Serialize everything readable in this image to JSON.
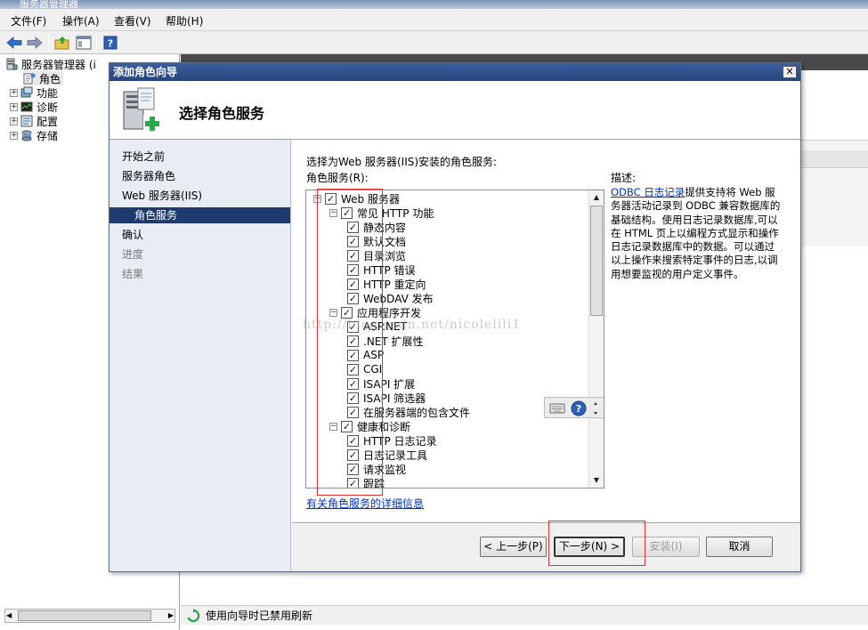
{
  "app": {
    "title": "服务器管理器",
    "menu": [
      "文件(F)",
      "操作(A)",
      "查看(V)",
      "帮助(H)"
    ],
    "tree": {
      "root": "服务器管理器 (i",
      "items": [
        "角色",
        "功能",
        "诊断",
        "配置",
        "存储"
      ]
    },
    "status_text": "使用向导时已禁用刷新"
  },
  "dialog": {
    "title": "添加角色向导",
    "close_label": "✕",
    "header_title": "选择角色服务",
    "nav": [
      "开始之前",
      "服务器角色",
      "Web 服务器(IIS)",
      "角色服务",
      "确认",
      "进度",
      "结果"
    ],
    "instruction": "选择为Web 服务器(IIS)安装的角色服务:",
    "list_label": "角色服务(R):",
    "tree": [
      {
        "label": "Web 服务器",
        "level": 0,
        "expander": "⊟",
        "checked": true
      },
      {
        "label": "常见 HTTP 功能",
        "level": 1,
        "expander": "⊟",
        "checked": true
      },
      {
        "label": "静态内容",
        "level": 2,
        "checked": true
      },
      {
        "label": "默认文档",
        "level": 2,
        "checked": true
      },
      {
        "label": "目录浏览",
        "level": 2,
        "checked": true
      },
      {
        "label": "HTTP 错误",
        "level": 2,
        "checked": true
      },
      {
        "label": "HTTP 重定向",
        "level": 2,
        "checked": true
      },
      {
        "label": "WebDAV 发布",
        "level": 2,
        "checked": true
      },
      {
        "label": "应用程序开发",
        "level": 1,
        "expander": "⊟",
        "checked": true
      },
      {
        "label": "ASP.NET",
        "level": 2,
        "checked": true
      },
      {
        "label": ".NET 扩展性",
        "level": 2,
        "checked": true
      },
      {
        "label": "ASP",
        "level": 2,
        "checked": true
      },
      {
        "label": "CGI",
        "level": 2,
        "checked": true
      },
      {
        "label": "ISAPI 扩展",
        "level": 2,
        "checked": true
      },
      {
        "label": "ISAPI 筛选器",
        "level": 2,
        "checked": true
      },
      {
        "label": "在服务器端的包含文件",
        "level": 2,
        "checked": true
      },
      {
        "label": "健康和诊断",
        "level": 1,
        "expander": "⊟",
        "checked": true
      },
      {
        "label": "HTTP 日志记录",
        "level": 2,
        "checked": true
      },
      {
        "label": "日志记录工具",
        "level": 2,
        "checked": true
      },
      {
        "label": "请求监视",
        "level": 2,
        "checked": true
      },
      {
        "label": "跟踪",
        "level": 2,
        "checked": true
      }
    ],
    "more_info_link": "有关角色服务的详细信息",
    "description_label": "描述:",
    "description_link": "ODBC 日志记录",
    "description_text": "提供支持将 Web 服务器活动记录到 ODBC 兼容数据库的基础结构。使用日志记录数据库,可以在 HTML 页上以编程方式显示和操作日志记录数据库中的数据。可以通过以上操作来搜索特定事件的日志,以调用想要监视的用户定义事件。",
    "buttons": {
      "previous": "< 上一步(P)",
      "next": "下一步(N) >",
      "install": "安装(I)",
      "cancel": "取消"
    }
  },
  "watermark": "http://blog.csdn.net/nicolelili1"
}
